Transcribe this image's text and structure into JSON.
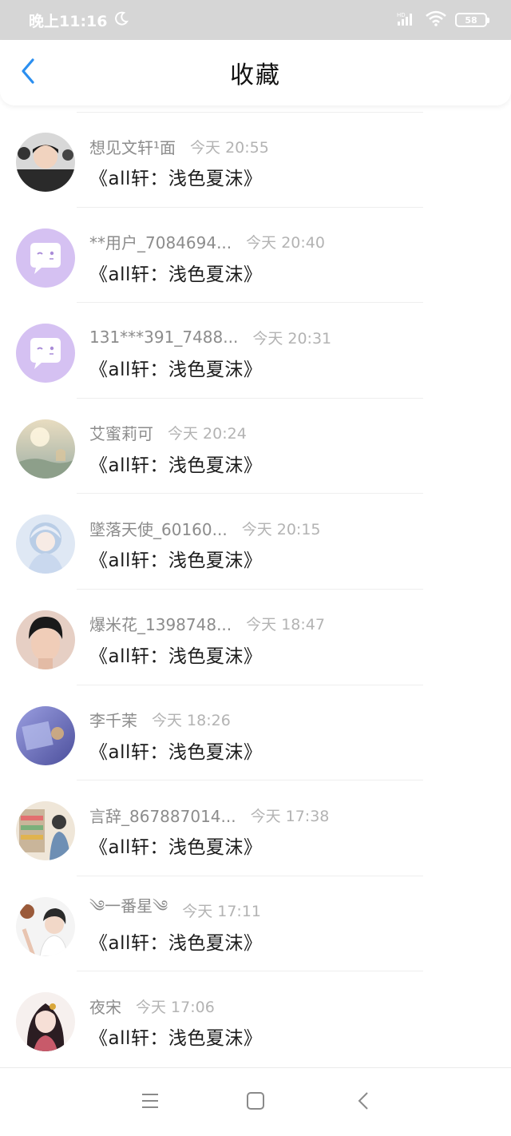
{
  "status_bar": {
    "time": "晚上11:16",
    "moon_icon": "moon-icon",
    "signal_icon": "signal-icon",
    "network": "HD",
    "wifi_icon": "wifi-icon",
    "battery": "58"
  },
  "header": {
    "title": "收藏",
    "back_icon": "chevron-left-icon",
    "accent_color": "#2b8ff0"
  },
  "favorites": [
    {
      "user": "想见文轩¹面",
      "time": "今天 20:55",
      "post": "《all轩：浅色夏沫》",
      "avatar": "photo-portrait"
    },
    {
      "user": "**用户_7084694...",
      "time": "今天 20:40",
      "post": "《all轩：浅色夏沫》",
      "avatar": "default-chat-avatar"
    },
    {
      "user": "131***391_7488...",
      "time": "今天 20:31",
      "post": "《all轩：浅色夏沫》",
      "avatar": "default-chat-avatar"
    },
    {
      "user": "艾蜜莉可",
      "time": "今天 20:24",
      "post": "《all轩：浅色夏沫》",
      "avatar": "landscape-sunlight"
    },
    {
      "user": "墜落天使_60160...",
      "time": "今天 20:15",
      "post": "《all轩：浅色夏沫》",
      "avatar": "anime-girl-blue"
    },
    {
      "user": "爆米花_1398748...",
      "time": "今天 18:47",
      "post": "《all轩：浅色夏沫》",
      "avatar": "photo-portrait"
    },
    {
      "user": "李千茉",
      "time": "今天 18:26",
      "post": "《all轩：浅色夏沫》",
      "avatar": "blue-purple-abstract"
    },
    {
      "user": "言辞_867887014...",
      "time": "今天 17:38",
      "post": "《all轩：浅色夏沫》",
      "avatar": "illustrated-shop"
    },
    {
      "user": "༄一番星༄",
      "time": "今天 17:11",
      "post": "《all轩：浅色夏沫》",
      "avatar": "illustrated-girl"
    },
    {
      "user": "夜宋",
      "time": "今天 17:06",
      "post": "《all轩：浅色夏沫》",
      "avatar": "illustrated-ancient-girl"
    }
  ],
  "nav_bar": {
    "menu_icon": "menu-icon",
    "home_icon": "home-square-icon",
    "back_icon": "back-triangle-icon"
  }
}
